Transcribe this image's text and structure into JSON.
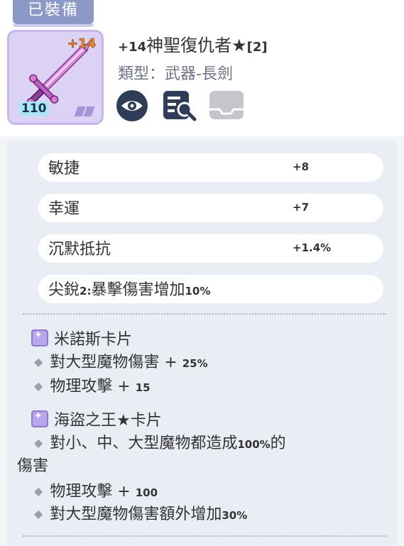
{
  "badge": "已裝備",
  "item": {
    "plus_badge": "+14",
    "level": "110",
    "title_plus": "+14",
    "title_name": "神聖復仇者★",
    "title_slots": "[2]",
    "type": "類型：武器-長劍"
  },
  "stats": [
    {
      "name": "敏捷",
      "value": "+8"
    },
    {
      "name": "幸運",
      "value": "+7"
    },
    {
      "name": "沉默抵抗",
      "value": "+1.4%"
    }
  ],
  "refine": {
    "text": "尖銳",
    "num": "2:",
    "text2": "暴擊傷害增加",
    "pct": "10%"
  },
  "card1": {
    "name": "米諾斯卡片",
    "lines": [
      {
        "text": "對大型魔物傷害 + ",
        "num": "25%"
      },
      {
        "text": "物理攻擊 + ",
        "num": "15"
      }
    ]
  },
  "card2": {
    "name": "海盜之王★卡片",
    "line1_text": "對小、中、大型魔物都造成",
    "line1_num": "100%",
    "line1_end": "的",
    "line1_wrap": "傷害",
    "line2_text": "物理攻擊 + ",
    "line2_num": "100",
    "line3_text": "對大型魔物傷害額外增加",
    "line3_num": "30%"
  },
  "colors": {
    "badge": "#8b98c8",
    "panel": "#e9edf4",
    "icon_dark": "#2e3e58",
    "icon_disabled": "#c4c6cc"
  }
}
